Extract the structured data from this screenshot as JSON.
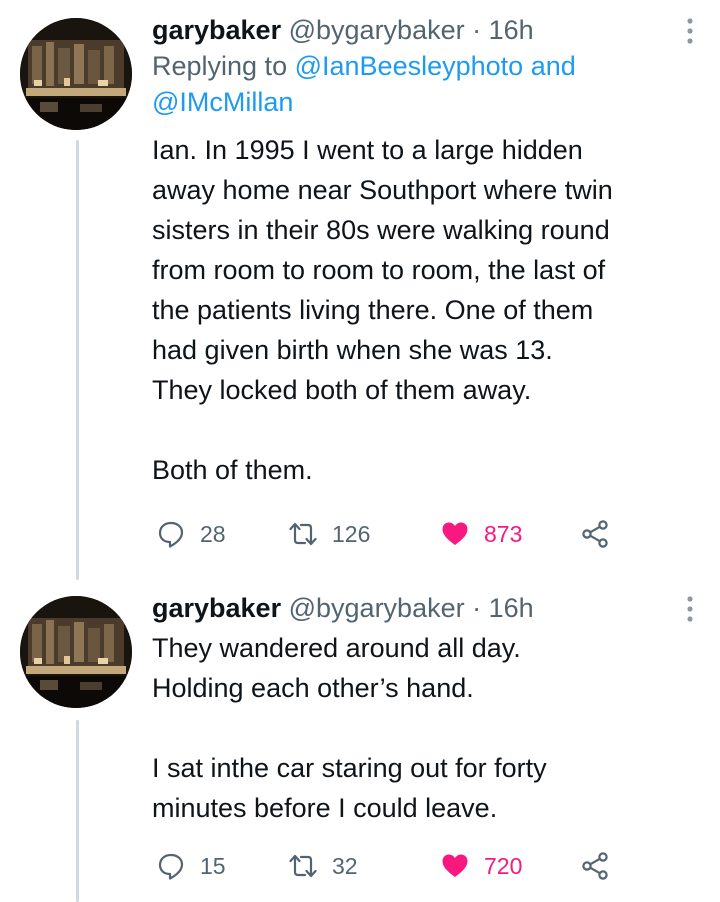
{
  "tweets": [
    {
      "display_name": "garybaker",
      "handle": "@bygarybaker",
      "separator": "·",
      "time": "16h",
      "replying_prefix": "Replying to",
      "replying_mention_1": "@IanBeesleyphoto",
      "replying_and": "and",
      "replying_mention_2": "@IMcMillan",
      "text": "Ian. In 1995 I went to a large hidden\naway home near Southport where twin\nsisters in their 80s were walking round\nfrom room to room to room, the last of\nthe patients living there. One of them\nhad given birth when she was 13.\nThey locked both of them away.\n\nBoth of them.",
      "replies": "28",
      "retweets": "126",
      "likes": "873"
    },
    {
      "display_name": "garybaker",
      "handle": "@bygarybaker",
      "separator": "·",
      "time": "16h",
      "text": "They wandered around all day.\nHolding each other’s hand.\n\nI sat inthe car staring out for forty\nminutes before I could leave.",
      "replies": "15",
      "retweets": "32",
      "likes": "720"
    }
  ],
  "colors": {
    "text": "#0f1419",
    "secondary": "#536471",
    "mention": "#1d9bf0",
    "like": "#f91880",
    "thread_line": "#cfd9de"
  },
  "icons": {
    "reply": "reply-icon",
    "retweet": "retweet-icon",
    "like": "heart-icon",
    "share": "share-icon",
    "more": "more-icon"
  }
}
